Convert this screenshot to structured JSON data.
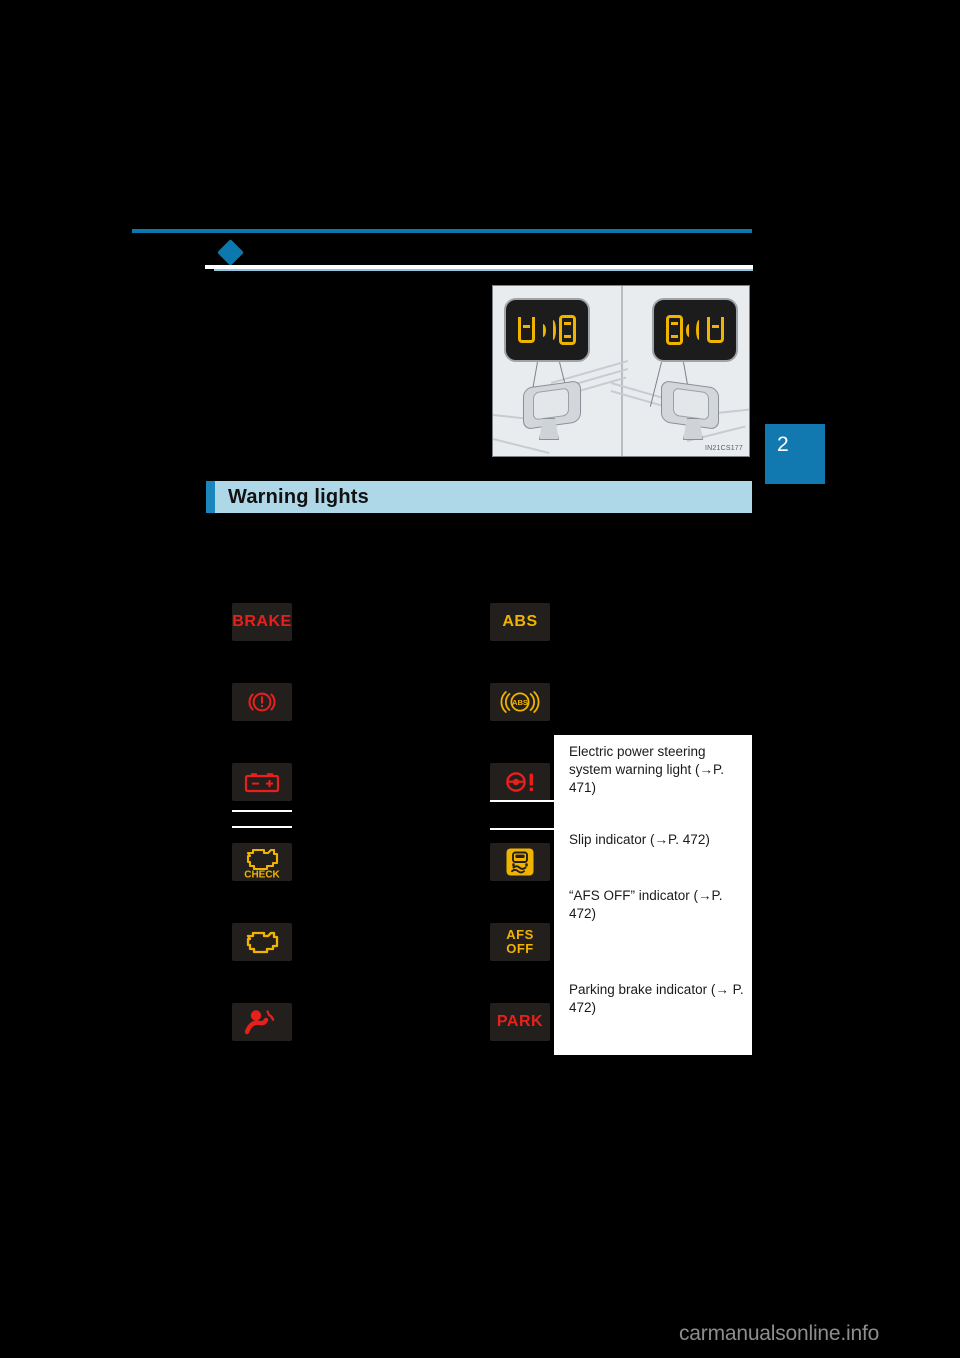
{
  "document": {
    "chapter_tab": "2",
    "figure_code": "IN21CS177",
    "watermark": "carmanualsonline.info"
  },
  "section": {
    "title": "Warning lights"
  },
  "figure": {
    "name": "blind-spot-monitor-outside-mirror-indicators",
    "badge_icon": "blind-spot-indicator-icon",
    "code": "IN21CS177"
  },
  "warning_lights": {
    "left_column": [
      {
        "icon": "brake-warning-text-icon",
        "label": "BRAKE",
        "color": "#e8201c",
        "type": "text"
      },
      {
        "icon": "brake-system-warning-icon",
        "label": "",
        "color": "#e8201c",
        "type": "glyph"
      },
      {
        "icon": "charging-system-battery-icon",
        "label": "",
        "color": "#e8201c",
        "type": "glyph"
      },
      {
        "icon": "check-engine-check-icon",
        "label": "CHECK",
        "color": "#f0b400",
        "type": "glyph"
      },
      {
        "icon": "malfunction-indicator-engine-icon",
        "label": "",
        "color": "#f0b400",
        "type": "glyph"
      },
      {
        "icon": "srs-airbag-warning-icon",
        "label": "",
        "color": "#e8201c",
        "type": "glyph"
      }
    ],
    "right_column": [
      {
        "icon": "abs-text-icon",
        "label": "ABS",
        "color": "#f0b400",
        "type": "text"
      },
      {
        "icon": "abs-circle-warning-icon",
        "label": "ABS",
        "color": "#f0b400",
        "type": "glyph"
      },
      {
        "icon": "electric-power-steering-warning-icon",
        "label": "",
        "color": "#e8201c",
        "type": "glyph"
      },
      {
        "icon": "slip-indicator-icon",
        "label": "",
        "color": "#f0b400",
        "type": "glyph"
      },
      {
        "icon": "afs-off-text-icon",
        "label": "AFS OFF",
        "color": "#f0b400",
        "type": "text"
      },
      {
        "icon": "parking-brake-park-icon",
        "label": "PARK",
        "color": "#e8201c",
        "type": "text"
      }
    ]
  },
  "descriptions": [
    "Electric power steering system warning light (→P. 471)",
    "Slip indicator (→P. 472)",
    "“AFS OFF” indicator (→P. 472)",
    "Parking brake indicator (→ P. 472)"
  ],
  "colors": {
    "accent_blue": "#0b78ae",
    "banner_blue": "#aed7e8",
    "banner_accent": "#1a86bb",
    "warning_red": "#e8201c",
    "warning_amber": "#f0b400",
    "tile_background": "#231f1d",
    "page_background": "#000000"
  }
}
